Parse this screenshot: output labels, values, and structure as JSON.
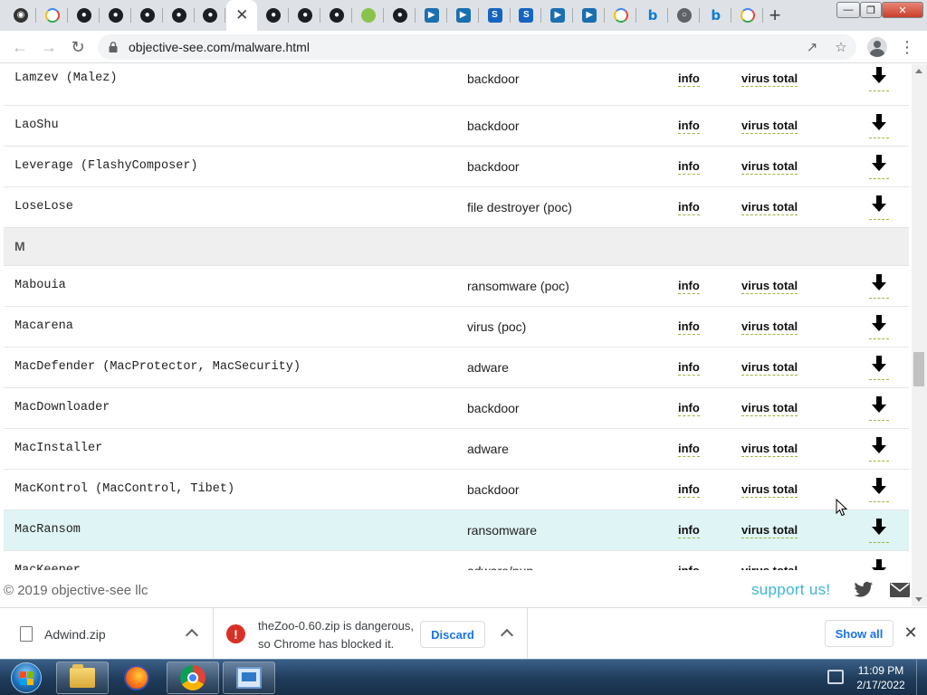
{
  "browser": {
    "url": "objective-see.com/malware.html",
    "tabs": [
      {
        "icon": "objective-see-icon"
      },
      {
        "icon": "google-icon"
      },
      {
        "icon": "github-icon"
      },
      {
        "icon": "github-icon"
      },
      {
        "icon": "github-icon"
      },
      {
        "icon": "github-icon"
      },
      {
        "icon": "github-icon"
      },
      {
        "icon": "close-icon",
        "active": true
      },
      {
        "icon": "github-icon"
      },
      {
        "icon": "github-icon"
      },
      {
        "icon": "github-icon"
      },
      {
        "icon": "android-icon"
      },
      {
        "icon": "github-icon"
      },
      {
        "icon": "arrow-app-icon"
      },
      {
        "icon": "arrow-app-icon"
      },
      {
        "icon": "s-app-icon"
      },
      {
        "icon": "s-app-icon"
      },
      {
        "icon": "arrow-app-icon"
      },
      {
        "icon": "arrow-app-icon"
      },
      {
        "icon": "google-icon"
      },
      {
        "icon": "bing-icon"
      },
      {
        "icon": "globe-icon"
      },
      {
        "icon": "bing-icon"
      },
      {
        "icon": "google-icon"
      }
    ]
  },
  "table": {
    "link_info": "info",
    "link_vt": "virus total",
    "rows": [
      {
        "kind": "item",
        "name": "Lamzev (Malez)",
        "type": "backdoor"
      },
      {
        "kind": "item",
        "name": "LaoShu",
        "type": "backdoor"
      },
      {
        "kind": "item",
        "name": "Leverage (FlashyComposer)",
        "type": "backdoor"
      },
      {
        "kind": "item",
        "name": "LoseLose",
        "type": "file destroyer (poc)"
      },
      {
        "kind": "section",
        "label": "M"
      },
      {
        "kind": "item",
        "name": "Mabouia",
        "type": "ransomware (poc)"
      },
      {
        "kind": "item",
        "name": "Macarena",
        "type": "virus (poc)"
      },
      {
        "kind": "item",
        "name": "MacDefender (MacProtector, MacSecurity)",
        "type": "adware"
      },
      {
        "kind": "item",
        "name": "MacDownloader",
        "type": "backdoor"
      },
      {
        "kind": "item",
        "name": "MacInstaller",
        "type": "adware"
      },
      {
        "kind": "item",
        "name": "MacKontrol (MacControl, Tibet)",
        "type": "backdoor"
      },
      {
        "kind": "item",
        "name": "MacRansom",
        "type": "ransomware",
        "highlight": true
      },
      {
        "kind": "item",
        "name": "MacKeeper",
        "type": "adware/pup"
      }
    ]
  },
  "footer": {
    "copyright": "© 2019 objective-see llc",
    "support": "support us!"
  },
  "downloads": {
    "item1_name": "Adwind.zip",
    "item2_line1": "theZoo-0.60.zip is dangerous,",
    "item2_line2": "so Chrome has blocked it.",
    "discard_label": "Discard",
    "show_all_label": "Show all"
  },
  "taskbar": {
    "time": "11:09 PM",
    "date": "2/17/2022"
  },
  "colors": {
    "link_underline": "#9ab340",
    "support_link": "#3fb5d6",
    "highlight_row": "#dff4f4",
    "chrome_blue": "#1a73e8",
    "danger": "#d93025"
  }
}
